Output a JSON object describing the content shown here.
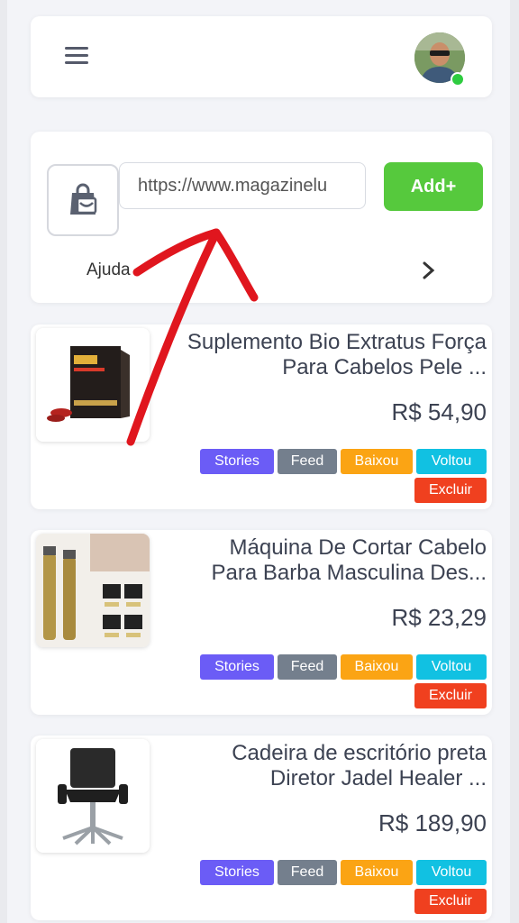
{
  "colors": {
    "add_button": "#56c93d",
    "stories": "#6b5cf6",
    "feed": "#747f8d",
    "baixou": "#fba414",
    "voltou": "#11c1e2",
    "excluir": "#f0401f",
    "annotation_arrow": "#e0161e"
  },
  "header": {
    "menu_icon": "hamburger-menu-icon",
    "avatar_icon": "user-avatar-photo"
  },
  "add_product": {
    "bag_icon": "shopping-bag-icon",
    "url_value": "https://www.magazinelu",
    "add_label": "Add+",
    "help_label": "Ajuda",
    "help_icon": "chevron-right-icon"
  },
  "tags": {
    "stories": "Stories",
    "feed": "Feed",
    "baixou": "Baixou",
    "voltou": "Voltou",
    "excluir": "Excluir"
  },
  "products": [
    {
      "title_line1": "Suplemento Bio Extratus Força",
      "title_line2": "Para Cabelos Pele ...",
      "price": "R$ 54,90",
      "image_icon": "supplement-box-image"
    },
    {
      "title_line1": "Máquina De Cortar Cabelo",
      "title_line2": "Para Barba Masculina Des...",
      "price": "R$ 23,29",
      "image_icon": "hair-clipper-image"
    },
    {
      "title_line1": "Cadeira de escritório preta",
      "title_line2": "Diretor Jadel Healer ...",
      "price": "R$ 189,90",
      "image_icon": "office-chair-image"
    }
  ]
}
